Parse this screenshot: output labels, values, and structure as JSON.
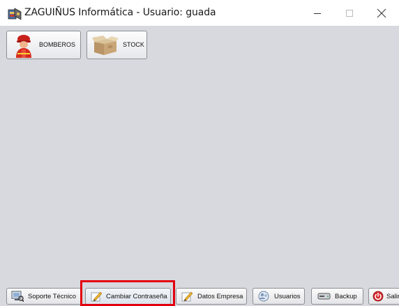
{
  "window": {
    "title": "ZAGUIÑUS Informática - Usuario: guada",
    "controls": [
      "minimize",
      "maximize",
      "close"
    ]
  },
  "modules": [
    {
      "label": "BOMBEROS",
      "icon": "firefighter-icon"
    },
    {
      "label": "STOCK",
      "icon": "box-icon"
    }
  ],
  "toolbar": {
    "soporte": "Soporte Técnico",
    "cambiar": "Cambiar Contraseña",
    "datos": "Datos Empresa",
    "usuarios": "Usuarios",
    "backup": "Backup",
    "salir": "Salir"
  },
  "colors": {
    "client_background": "#d7d9df",
    "highlight": "#e3000f"
  }
}
